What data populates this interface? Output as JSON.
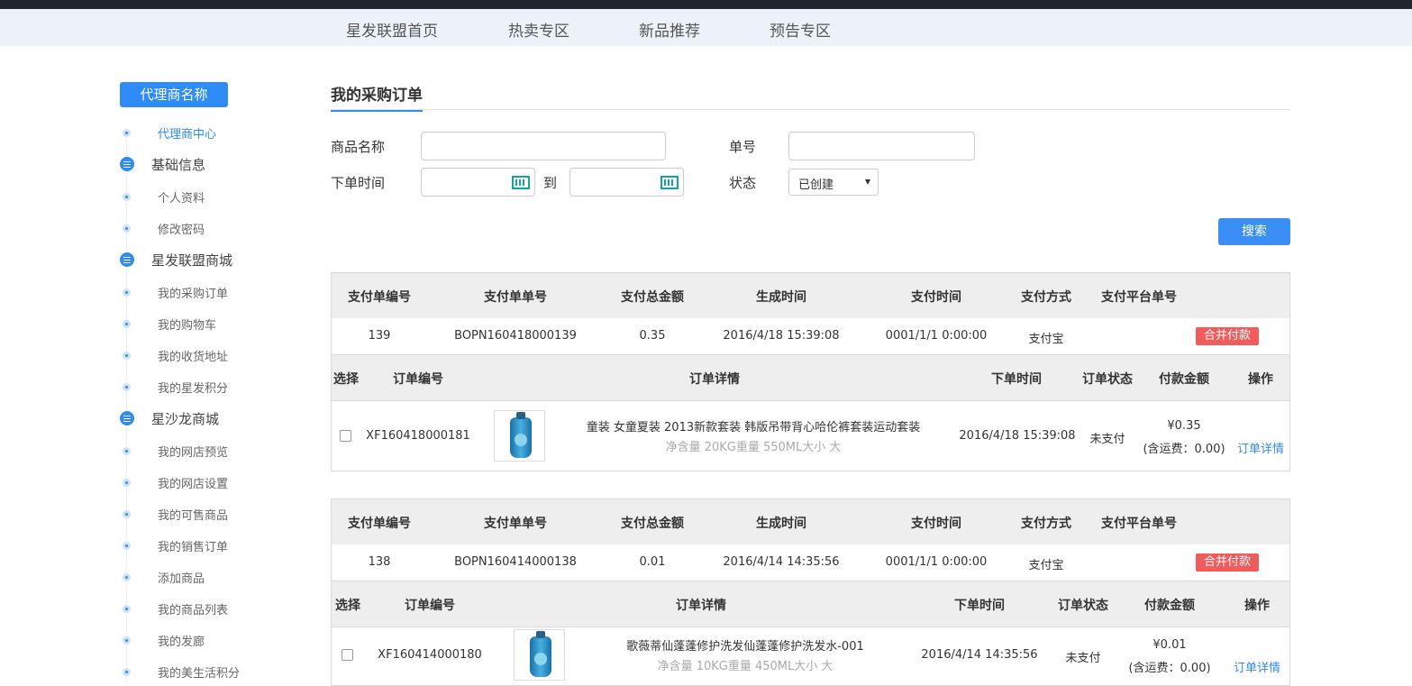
{
  "nav": {
    "items": [
      "星发联盟首页",
      "热卖专区",
      "新品推荐",
      "预告专区"
    ]
  },
  "sidebar": {
    "header": "代理商名称",
    "entries": [
      {
        "type": "item",
        "label": "代理商中心",
        "active": true
      },
      {
        "type": "group",
        "label": "基础信息"
      },
      {
        "type": "item",
        "label": "个人资料"
      },
      {
        "type": "item",
        "label": "修改密码"
      },
      {
        "type": "group",
        "label": "星发联盟商城"
      },
      {
        "type": "item",
        "label": "我的采购订单"
      },
      {
        "type": "item",
        "label": "我的购物车"
      },
      {
        "type": "item",
        "label": "我的收货地址"
      },
      {
        "type": "item",
        "label": "我的星发积分"
      },
      {
        "type": "group",
        "label": "星沙龙商城"
      },
      {
        "type": "item",
        "label": "我的网店预览"
      },
      {
        "type": "item",
        "label": "我的网店设置"
      },
      {
        "type": "item",
        "label": "我的可售商品"
      },
      {
        "type": "item",
        "label": "我的销售订单"
      },
      {
        "type": "item",
        "label": "添加商品"
      },
      {
        "type": "item",
        "label": "我的商品列表"
      },
      {
        "type": "item",
        "label": "我的发廊"
      },
      {
        "type": "item",
        "label": "我的美生活积分"
      }
    ]
  },
  "main": {
    "title": "我的采购订单"
  },
  "filters": {
    "product_name_label": "商品名称",
    "order_no_label": "单号",
    "order_time_label": "下单时间",
    "to_label": "到",
    "status_label": "状态",
    "status_value": "已创建",
    "search_label": "搜索"
  },
  "payment_headers": [
    "支付单编号",
    "支付单单号",
    "支付总金额",
    "生成时间",
    "支付时间",
    "支付方式",
    "支付平台单号"
  ],
  "order_headers": [
    "选择",
    "订单编号",
    "订单详情",
    "下单时间",
    "订单状态",
    "付款金额",
    "操作"
  ],
  "merge_pay_label": "合并付款",
  "detail_link_label": "订单详情",
  "payments": [
    {
      "id": "139",
      "no": "BOPN160418000139",
      "total": "0.35",
      "created": "2016/4/18 15:39:08",
      "paid_time": "0001/1/1 0:00:00",
      "method": "支付宝",
      "platform_no": "",
      "order": {
        "no": "XF160418000181",
        "name": "童装 女童夏装 2013新款套装 韩版吊带背心哈伦裤套装运动套装",
        "spec": "净含量 20KG重量 550ML大小 大",
        "time": "2016/4/18 15:39:08",
        "status": "未支付",
        "amount": "¥0.35",
        "freight": "(含运费：0.00)"
      }
    },
    {
      "id": "138",
      "no": "BOPN160414000138",
      "total": "0.01",
      "created": "2016/4/14 14:35:56",
      "paid_time": "0001/1/1 0:00:00",
      "method": "支付宝",
      "platform_no": "",
      "order": {
        "no": "XF160414000180",
        "name": "歌薇蒂仙蓬蓬修护洗发仙蓬蓬修护洗发水-001",
        "spec": "净含量 10KG重量 450ML大小 大",
        "time": "2016/4/14 14:35:56",
        "status": "未支付",
        "amount": "¥0.01",
        "freight": "(含运费：0.00)"
      }
    }
  ],
  "colors": {
    "accent": "#2f8bf5",
    "danger": "#f25b5b",
    "topbar": "#23262e",
    "nav_bg": "#edf2fa"
  }
}
